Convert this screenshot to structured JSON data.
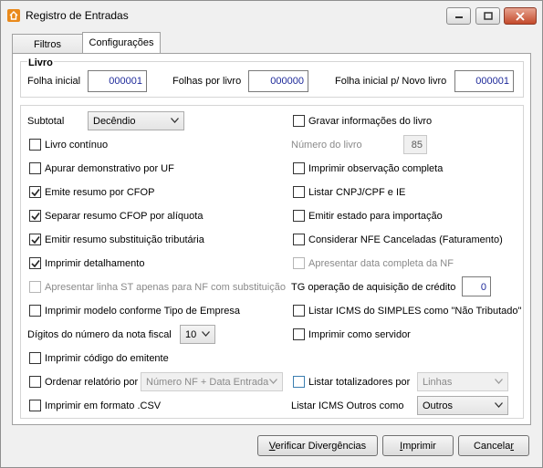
{
  "window": {
    "title": "Registro de Entradas"
  },
  "tabs": [
    {
      "label": "Filtros"
    },
    {
      "label": "Configurações"
    }
  ],
  "livro": {
    "group_title": "Livro",
    "folha_inicial_label": "Folha inicial",
    "folha_inicial_value": "000001",
    "folhas_por_livro_label": "Folhas por livro",
    "folhas_por_livro_value": "000000",
    "folha_inicial_novo_label": "Folha inicial p/ Novo livro",
    "folha_inicial_novo_value": "000001"
  },
  "left": {
    "subtotal_label": "Subtotal",
    "subtotal_value": "Decêndio",
    "livro_continuo": "Livro contínuo",
    "apurar_demonstrativo": "Apurar demonstrativo por UF",
    "emite_resumo_cfop": "Emite resumo por CFOP",
    "separar_resumo": "Separar resumo CFOP por alíquota",
    "emitir_resumo_st": "Emitir resumo substituição tributária",
    "imprimir_detalhamento": "Imprimir detalhamento",
    "apresentar_linha_st": "Apresentar linha ST apenas para NF com substituição",
    "imprimir_modelo": "Imprimir modelo conforme Tipo de Empresa",
    "digitos_label": "Dígitos do número da nota fiscal",
    "digitos_value": "10",
    "imprimir_codigo": "Imprimir código do emitente",
    "ordenar_label": "Ordenar relatório por",
    "ordenar_value": "Número NF + Data Entrada",
    "imprimir_csv": "Imprimir em formato .CSV"
  },
  "right": {
    "gravar_info": "Gravar informações do livro",
    "numero_livro_label": "Número do livro",
    "numero_livro_value": "85",
    "imprimir_obs": "Imprimir observação completa",
    "listar_cnpj": "Listar CNPJ/CPF e IE",
    "emitir_estado": "Emitir estado para importação",
    "considerar_nfe": "Considerar NFE Canceladas (Faturamento)",
    "apresentar_data": "Apresentar data completa da NF",
    "tg_label": "TG operação de aquisição de crédito",
    "tg_value": "0",
    "listar_icms_simples": "Listar ICMS do SIMPLES como \"Não Tributado\"",
    "imprimir_servidor": "Imprimir como servidor",
    "listar_totalizadores": "Listar totalizadores por",
    "totalizadores_value": "Linhas",
    "listar_icms_outros_label": "Listar ICMS Outros como",
    "icms_outros_value": "Outros"
  },
  "checks": {
    "livro_continuo": false,
    "apurar_demonstrativo": false,
    "emite_resumo_cfop": true,
    "separar_resumo": true,
    "emitir_resumo_st": true,
    "imprimir_detalhamento": true,
    "apresentar_linha_st": false,
    "imprimir_modelo": false,
    "imprimir_codigo": false,
    "ordenar": false,
    "imprimir_csv": false,
    "gravar_info": false,
    "imprimir_obs": false,
    "listar_cnpj": false,
    "emitir_estado": false,
    "considerar_nfe": false,
    "apresentar_data": false,
    "listar_icms_simples": false,
    "imprimir_servidor": false,
    "listar_totalizadores": false
  },
  "buttons": {
    "verificar_pre": "V",
    "verificar_rest": "erificar Divergências",
    "imprimir_pre": "I",
    "imprimir_rest": "mprimir",
    "cancelar_pre": "Cancela",
    "cancelar_u": "r"
  },
  "colors": {
    "accent": "#1e2a9a",
    "app_icon": "#e98a1c",
    "close_button": "#c44a2b"
  }
}
